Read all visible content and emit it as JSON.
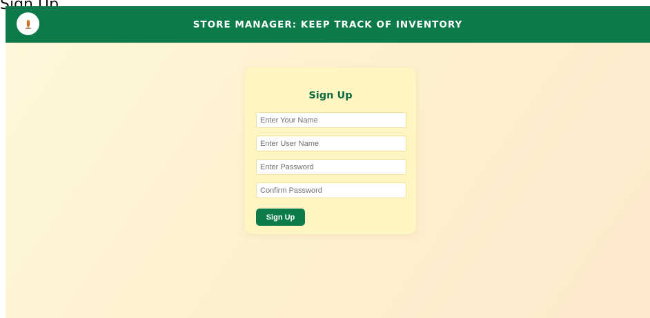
{
  "page": {
    "caption": "Sign Up"
  },
  "header": {
    "title": "STORE MANAGER: KEEP TRACK OF INVENTORY",
    "logo_icon": "pencil-icon"
  },
  "form": {
    "title": "Sign Up",
    "fields": [
      {
        "placeholder": "Enter Your Name",
        "value": ""
      },
      {
        "placeholder": "Enter User Name",
        "value": ""
      },
      {
        "placeholder": "Enter Password",
        "value": ""
      },
      {
        "placeholder": "Confirm Password",
        "value": ""
      }
    ],
    "submit_label": "Sign Up"
  },
  "colors": {
    "primary_green": "#0d7a4a",
    "card_bg": "#fef6c2",
    "page_bg": "#fdf1cf"
  }
}
